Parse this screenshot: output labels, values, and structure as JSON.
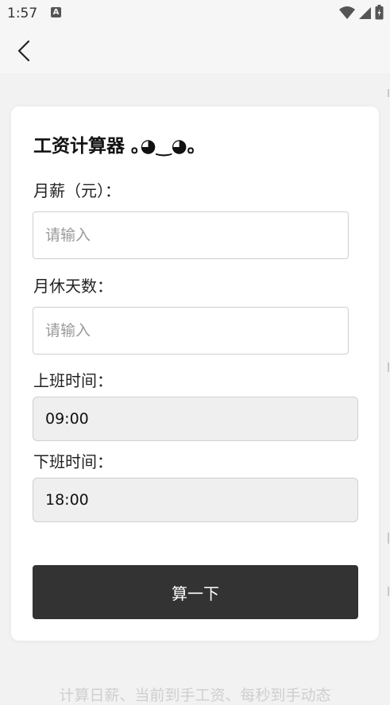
{
  "status_bar": {
    "time": "1:57",
    "notification_icon": "a-app-icon",
    "icons": [
      "wifi-icon",
      "cell-signal-icon",
      "battery-icon"
    ]
  },
  "app_bar": {
    "back_icon": "chevron-left-icon"
  },
  "form": {
    "title": "工资计算器 ｡◕‿◕｡",
    "fields": [
      {
        "label": "月薪（元）：",
        "placeholder": "请输入",
        "value": ""
      },
      {
        "label": "月休天数：",
        "placeholder": "请输入",
        "value": ""
      },
      {
        "label": "上班时间：",
        "value": "09:00"
      },
      {
        "label": "下班时间：",
        "value": "18:00"
      }
    ],
    "submit_label": "算一下"
  },
  "footer": {
    "hint": "计算日薪、当前到手工资、每秒到手动态"
  },
  "colors": {
    "background": "#f2f2f2",
    "card": "#ffffff",
    "button": "#333333",
    "time_field_bg": "#efefef"
  }
}
